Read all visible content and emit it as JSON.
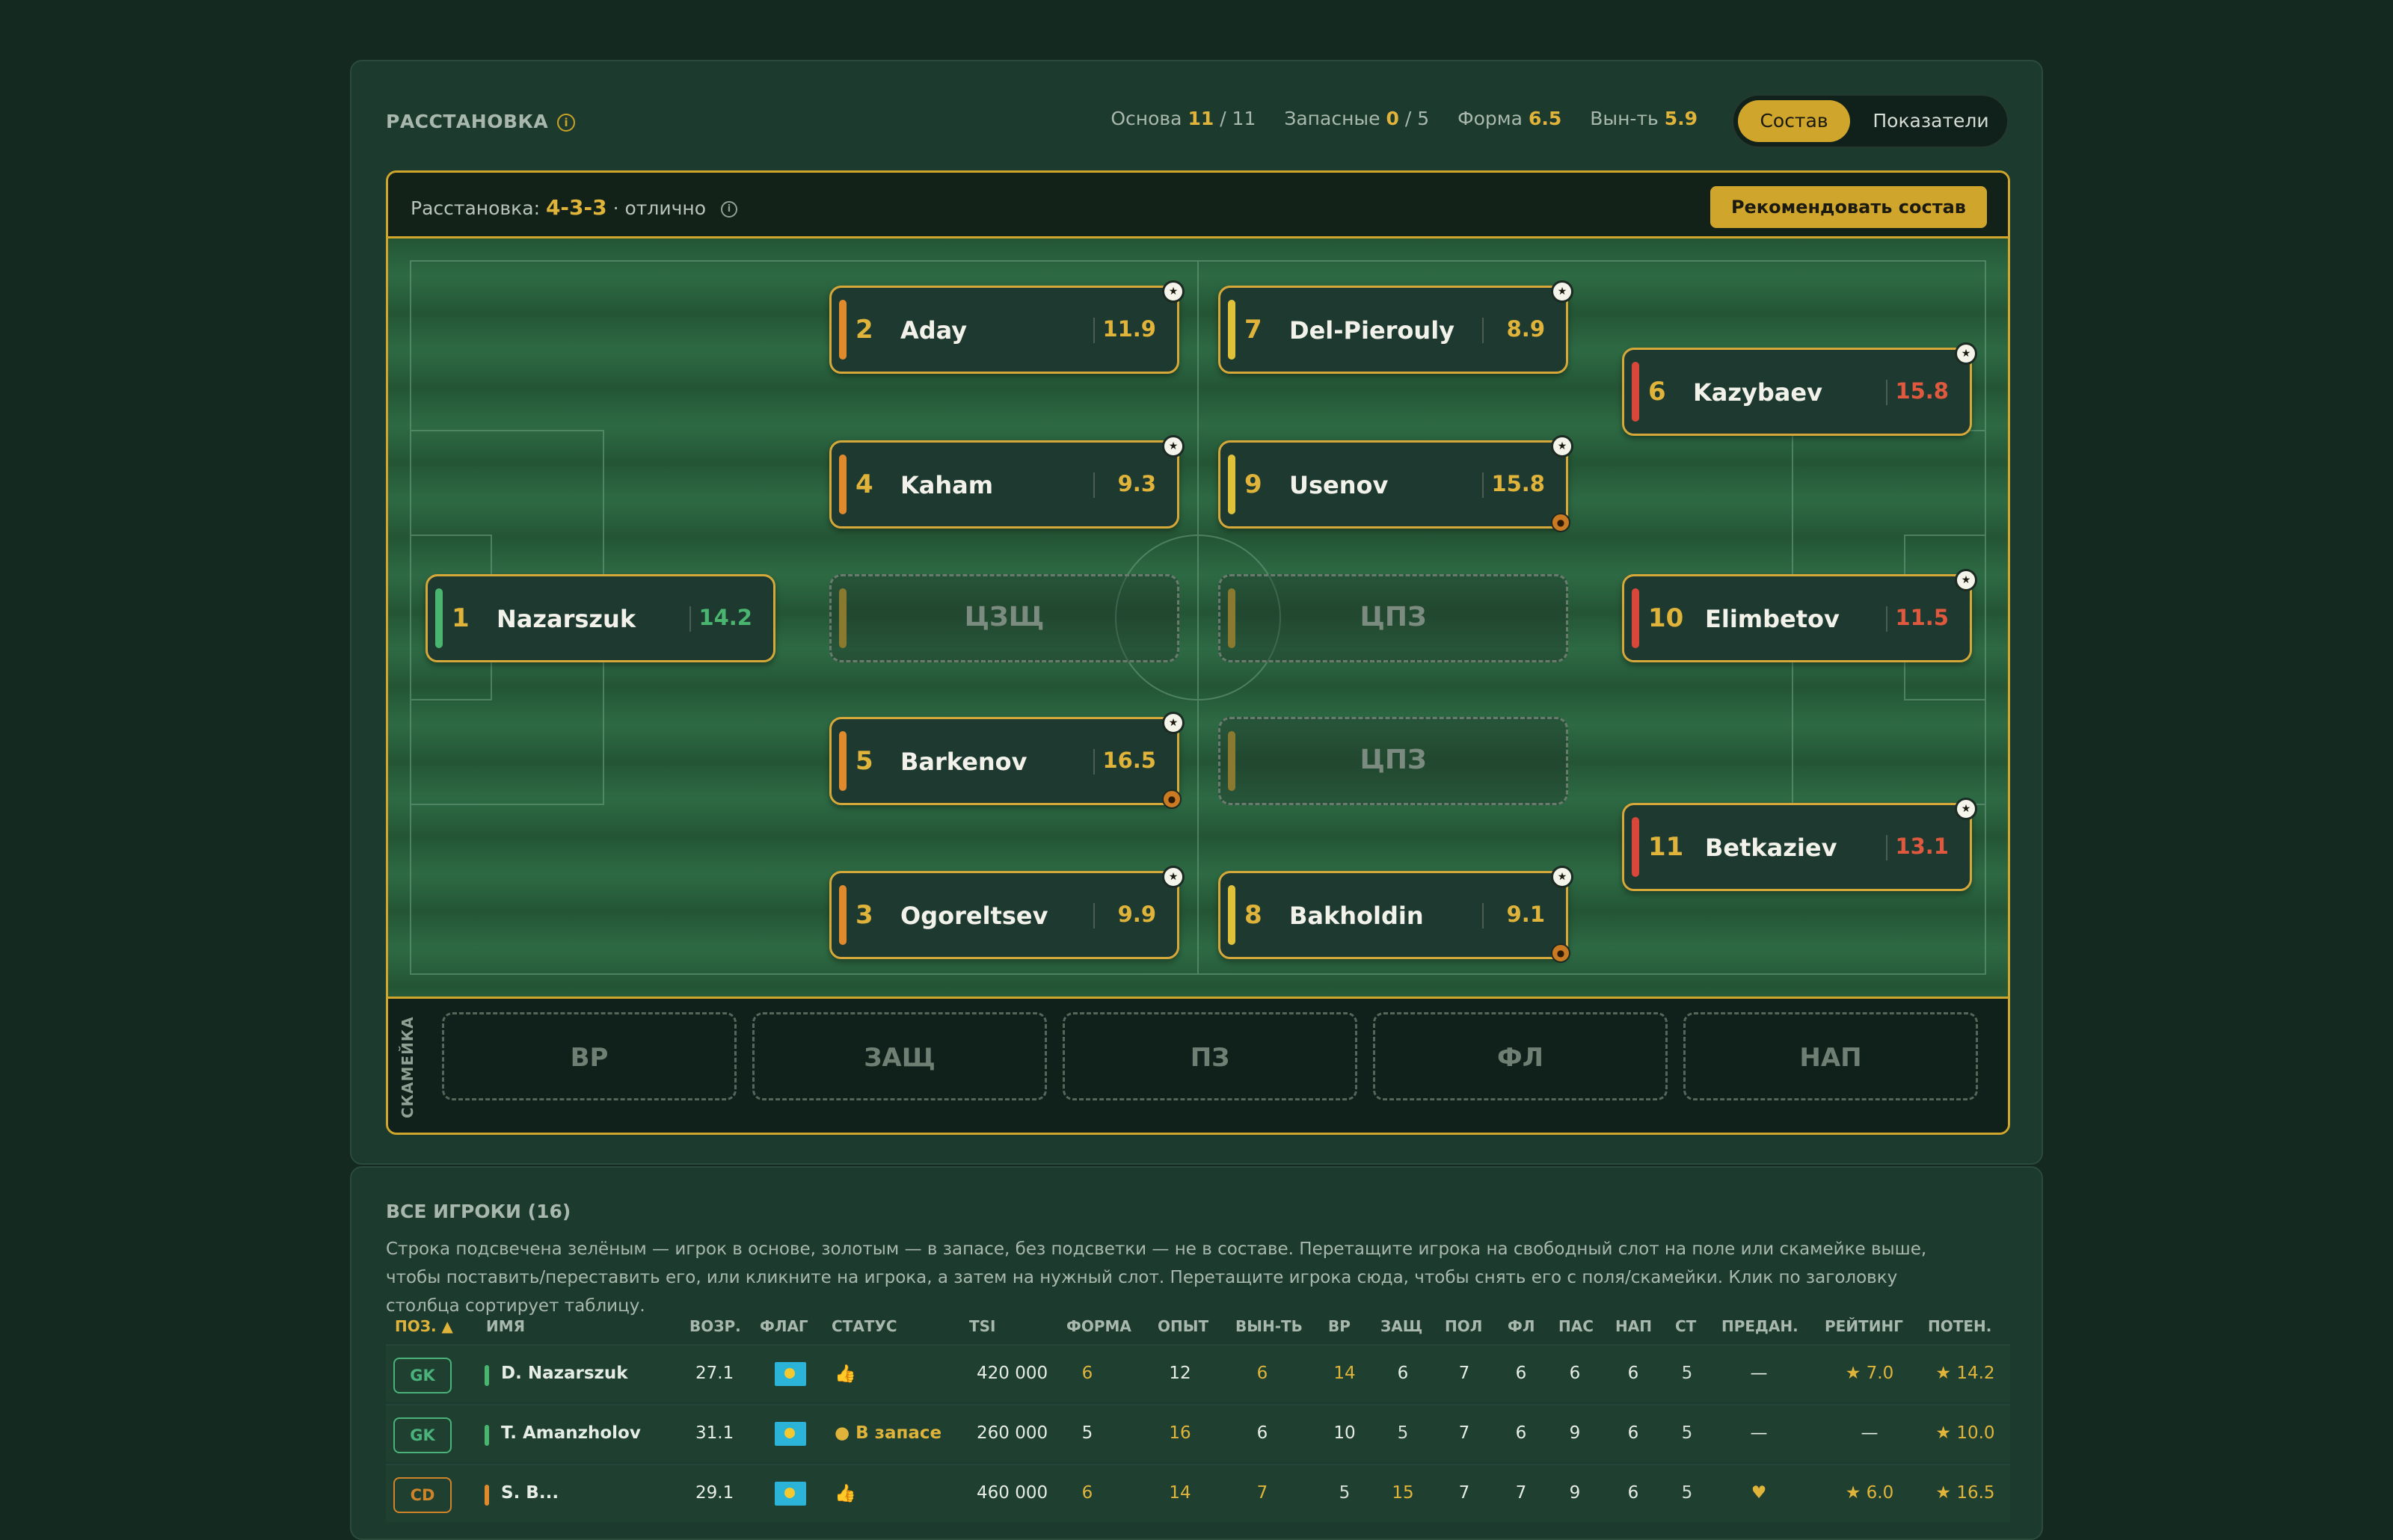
{
  "lineup": {
    "title": "РАССТАНОВКА",
    "info_icon": "info-icon",
    "stats": [
      {
        "label": "Основа",
        "value": "11",
        "total": "/ 11"
      },
      {
        "label": "Запасные",
        "value": "0",
        "total": "/ 5"
      },
      {
        "label": "Форма",
        "value": "6.5",
        "total": ""
      },
      {
        "label": "Вын-ть",
        "value": "5.9",
        "total": ""
      }
    ],
    "view_toggle": {
      "active": "Состав",
      "other": "Показатели"
    },
    "formation": {
      "prefix": "Расстановка:",
      "value": "4-3-3",
      "suffix": "· отлично"
    },
    "recommend_button": "Рекомендовать состав",
    "players": [
      {
        "num": "1",
        "name": "Nazarszuk",
        "rating": "14.2",
        "line_color": "#49b56f",
        "rating_color": "#49b56f",
        "star": false,
        "medal": false
      },
      {
        "num": "2",
        "name": "Aday",
        "rating": "11.9",
        "line_color": "#e08a2e",
        "rating_color": "#e0b43a",
        "star": true,
        "medal": false
      },
      {
        "num": "4",
        "name": "Kaham",
        "rating": "9.3",
        "line_color": "#e08a2e",
        "rating_color": "#e0b43a",
        "star": true,
        "medal": false
      },
      {
        "num": "5",
        "name": "Barkenov",
        "rating": "16.5",
        "line_color": "#e08a2e",
        "rating_color": "#e0b43a",
        "star": true,
        "medal": true
      },
      {
        "num": "3",
        "name": "Ogoreltsev",
        "rating": "9.9",
        "line_color": "#e08a2e",
        "rating_color": "#e0b43a",
        "star": true,
        "medal": false
      },
      {
        "num": "7",
        "name": "Del-Pierouly",
        "rating": "8.9",
        "line_color": "#e0c23a",
        "rating_color": "#e0b43a",
        "star": true,
        "medal": false
      },
      {
        "num": "9",
        "name": "Usenov",
        "rating": "15.8",
        "line_color": "#e0c23a",
        "rating_color": "#e0b43a",
        "star": true,
        "medal": true
      },
      {
        "num": "8",
        "name": "Bakholdin",
        "rating": "9.1",
        "line_color": "#e0c23a",
        "rating_color": "#e0b43a",
        "star": true,
        "medal": true
      },
      {
        "num": "6",
        "name": "Kazybaev",
        "rating": "15.8",
        "line_color": "#d9473a",
        "rating_color": "#e0593f",
        "star": true,
        "medal": false
      },
      {
        "num": "10",
        "name": "Elimbetov",
        "rating": "11.5",
        "line_color": "#d9473a",
        "rating_color": "#e0593f",
        "star": true,
        "medal": false
      },
      {
        "num": "11",
        "name": "Betkaziev",
        "rating": "13.1",
        "line_color": "#d9473a",
        "rating_color": "#e0593f",
        "star": true,
        "medal": false
      }
    ],
    "empty_slots": [
      "ЦЗЩ",
      "ЦПЗ",
      "ЦПЗ"
    ],
    "bench_label": "СКАМЕЙКА",
    "bench_slots": [
      "ВР",
      "ЗАЩ",
      "ПЗ",
      "ФЛ",
      "НАП"
    ]
  },
  "all_players": {
    "title": "ВСЕ ИГРОКИ (16)",
    "description": "Строка подсвечена зелёным — игрок в основе, золотым — в запасе, без подсветки — не в составе. Перетащите игрока на свободный слот на поле или скамейке выше, чтобы поставить/переставить его, или кликните на игрока, а затем на нужный слот. Перетащите игрока сюда, чтобы снять его с поля/скамейки. Клик по заголовку столбца сортирует таблицу.",
    "columns": [
      "ПОЗ. ▲",
      "ИМЯ",
      "ВОЗР.",
      "ФЛАГ",
      "СТАТУС",
      "TSI",
      "ФОРМА",
      "ОПЫТ",
      "ВЫН-ТЬ",
      "ВР",
      "ЗАЩ",
      "ПОЛ",
      "ФЛ",
      "ПАС",
      "НАП",
      "СТ",
      "ПРЕДАН.",
      "РЕЙТИНГ",
      "ПОТЕН."
    ],
    "rows": [
      {
        "pos": "GK",
        "name": "D. Nazarszuk",
        "age": "27.1",
        "status": "",
        "status_icon": "thumbs-up-icon",
        "tsi": "420 000",
        "form": "6",
        "exp": "12",
        "stamina": "6",
        "gk": "14",
        "def": "6",
        "mid": "7",
        "wing": "6",
        "pass": "6",
        "att": "6",
        "sp": "5",
        "loyal": "—",
        "rating": "★ 7.0",
        "potential": "★ 14.2"
      },
      {
        "pos": "GK",
        "name": "T. Amanzholov",
        "age": "31.1",
        "status": "В запасе",
        "status_icon": "dot-icon",
        "tsi": "260 000",
        "form": "5",
        "exp": "16",
        "stamina": "6",
        "gk": "10",
        "def": "5",
        "mid": "7",
        "wing": "6",
        "pass": "9",
        "att": "6",
        "sp": "5",
        "loyal": "—",
        "rating": "—",
        "potential": "★ 10.0"
      },
      {
        "pos": "CD",
        "name": "S. B...",
        "age": "29.1",
        "status": "",
        "status_icon": "thumbs-up-icon",
        "tsi": "460 000",
        "form": "6",
        "exp": "14",
        "stamina": "7",
        "gk": "5",
        "def": "15",
        "mid": "7",
        "wing": "7",
        "pass": "9",
        "att": "6",
        "sp": "5",
        "loyal": "♥",
        "rating": "★ 6.0",
        "potential": "★ 16.5"
      }
    ]
  }
}
